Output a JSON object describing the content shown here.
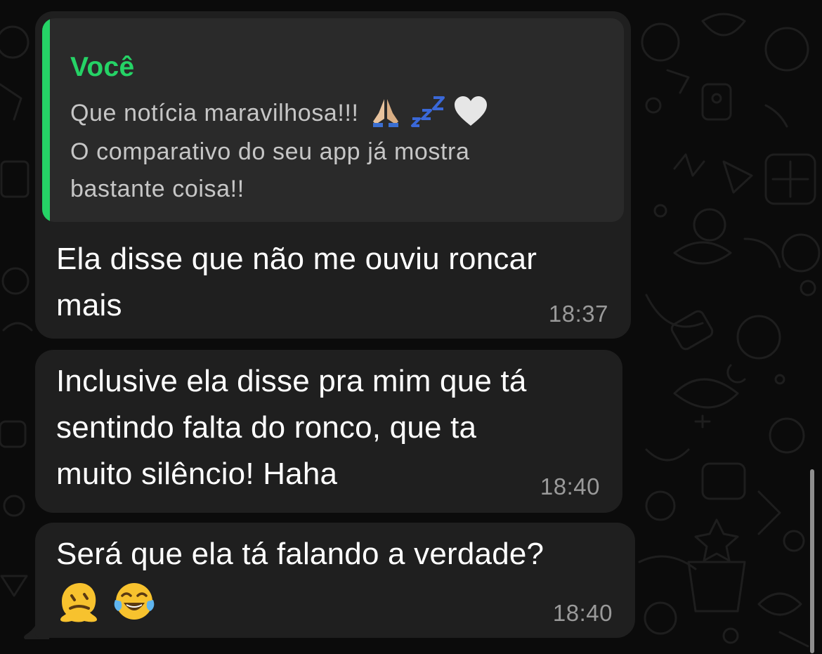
{
  "messages": [
    {
      "quote": {
        "author": "Você",
        "lines": [
          "Que notícia maravilhosa!!!",
          "O comparativo do seu app já mostra",
          "bastante coisa!!"
        ],
        "emojis": [
          "folded-hands-icon",
          "zzz-icon",
          "white-heart-icon"
        ]
      },
      "lines": [
        "Ela disse que não me ouviu roncar",
        "mais"
      ],
      "time": "18:37"
    },
    {
      "lines": [
        "Inclusive ela disse pra mim que tá",
        "sentindo falta do ronco, que ta",
        "muito silêncio! Haha"
      ],
      "time": "18:40"
    },
    {
      "lines": [
        "Será que ela tá falando a verdade?"
      ],
      "emojis": [
        "melting-face-icon",
        "face-with-tears-of-joy-icon"
      ],
      "time": "18:40"
    }
  ],
  "colors": {
    "background": "#0b0b0b",
    "bubble": "#1f1f1f",
    "quote_background": "#2a2a2a",
    "accent": "#25d366",
    "timestamp": "#9a9a9a"
  }
}
